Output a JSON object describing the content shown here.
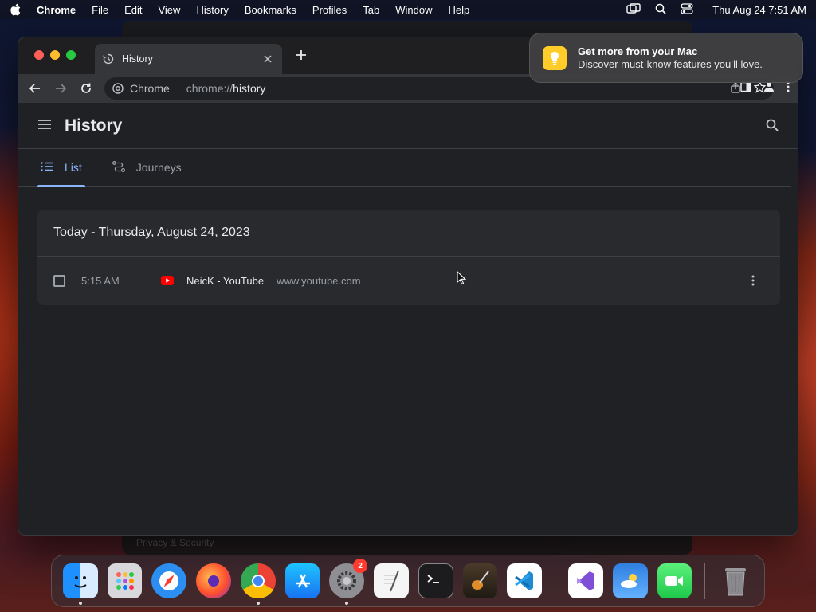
{
  "menubar": {
    "app": "Chrome",
    "items": [
      "File",
      "Edit",
      "View",
      "History",
      "Bookmarks",
      "Profiles",
      "Tab",
      "Window",
      "Help"
    ],
    "clock": "Thu Aug 24  7:51 AM"
  },
  "background_window": {
    "label": "Privacy & Security"
  },
  "browser": {
    "tab": {
      "title": "History"
    },
    "omnibox": {
      "site_label": "Chrome",
      "url_scheme": "chrome://",
      "url_path": "history"
    }
  },
  "history": {
    "title": "History",
    "tabs": [
      {
        "label": "List",
        "active": true
      },
      {
        "label": "Journeys",
        "active": false
      }
    ],
    "day_header": "Today - Thursday, August 24, 2023",
    "entries": [
      {
        "time": "5:15 AM",
        "title": "NeicK - YouTube",
        "domain": "www.youtube.com"
      }
    ]
  },
  "notification": {
    "title": "Get more from your Mac",
    "body": "Discover must-know features you’ll love."
  },
  "dock": {
    "apps": [
      "Finder",
      "Launchpad",
      "Safari",
      "Firefox",
      "Chrome",
      "App Store",
      "System Settings",
      "TextEdit",
      "Terminal",
      "GarageBand",
      "Visual Studio Code",
      "Visual Studio",
      "Weather",
      "FaceTime",
      "Trash"
    ],
    "system_settings_badge": "2"
  },
  "colors": {
    "accent": "#8ab4f8",
    "page_bg": "#202124",
    "card_bg": "#292a2d"
  }
}
